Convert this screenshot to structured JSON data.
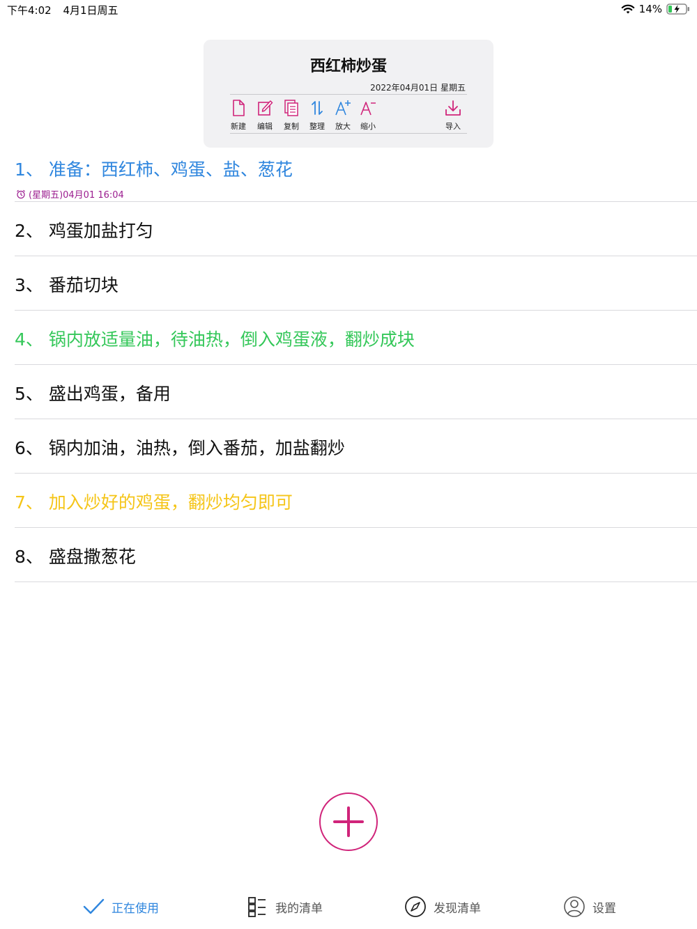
{
  "status": {
    "time": "下午4:02",
    "date": "4月1日周五",
    "battery": "14%"
  },
  "header": {
    "title": "西红柿炒蛋",
    "date": "2022年04月01日 星期五",
    "tools": [
      "新建",
      "编辑",
      "复制",
      "整理",
      "放大",
      "缩小",
      "导入"
    ]
  },
  "items": [
    {
      "text": "1、 准备：西红柿、鸡蛋、盐、葱花",
      "color": "#2f86de",
      "alarm": "(星期五)04月01 16:04"
    },
    {
      "text": "2、 鸡蛋加盐打匀",
      "color": "#111111"
    },
    {
      "text": "3、 番茄切块",
      "color": "#111111"
    },
    {
      "text": "4、 锅内放适量油，待油热，倒入鸡蛋液，翻炒成块",
      "color": "#34c759"
    },
    {
      "text": "5、 盛出鸡蛋，备用",
      "color": "#111111"
    },
    {
      "text": "6、 锅内加油，油热，倒入番茄，加盐翻炒",
      "color": "#111111"
    },
    {
      "text": "7、 加入炒好的鸡蛋，翻炒均匀即可",
      "color": "#f5c518"
    },
    {
      "text": "8、 盛盘撒葱花",
      "color": "#111111"
    }
  ],
  "tabs": [
    {
      "label": "正在使用",
      "icon": "checkmark-icon",
      "active": true
    },
    {
      "label": "我的清单",
      "icon": "list-icon",
      "active": false
    },
    {
      "label": "发现清单",
      "icon": "compass-icon",
      "active": false
    },
    {
      "label": "设置",
      "icon": "person-icon",
      "active": false
    }
  ],
  "colors": {
    "accent": "#d0247a",
    "active_tab": "#2f86de",
    "inactive_tab": "#555555",
    "alarm": "#9b1d8f"
  }
}
